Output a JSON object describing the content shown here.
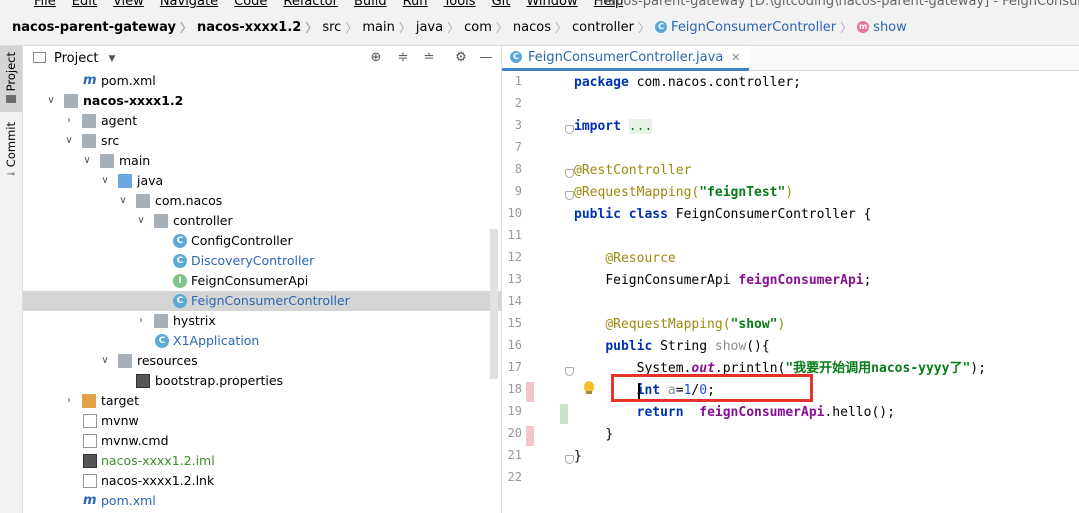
{
  "menubar": {
    "items": [
      "File",
      "Edit",
      "View",
      "Navigate",
      "Code",
      "Refactor",
      "Build",
      "Run",
      "Tools",
      "Git",
      "Window",
      "Help"
    ],
    "window_title": "nacos-parent-gateway [D:\\gitcoding\\nacos-parent-gateway] - FeignConsumerController"
  },
  "breadcrumb": {
    "items": [
      "nacos-parent-gateway",
      "nacos-xxxx1.2",
      "src",
      "main",
      "java",
      "com",
      "nacos",
      "controller",
      "FeignConsumerController",
      "show"
    ]
  },
  "left_strip": {
    "project_label": "Project",
    "commit_label": "Commit"
  },
  "project_panel": {
    "title": "Project",
    "tree": [
      {
        "label": "pom.xml",
        "icon": "maven-icon"
      },
      {
        "label": "nacos-xxxx1.2",
        "icon": "module-folder-icon"
      },
      {
        "label": "agent",
        "icon": "folder-icon"
      },
      {
        "label": "src",
        "icon": "folder-icon"
      },
      {
        "label": "main",
        "icon": "folder-icon"
      },
      {
        "label": "java",
        "icon": "source-folder-icon"
      },
      {
        "label": "com.nacos",
        "icon": "package-icon"
      },
      {
        "label": "controller",
        "icon": "package-icon"
      },
      {
        "label": "ConfigController",
        "icon": "class-icon"
      },
      {
        "label": "DiscoveryController",
        "icon": "class-icon"
      },
      {
        "label": "FeignConsumerApi",
        "icon": "interface-icon"
      },
      {
        "label": "FeignConsumerController",
        "icon": "class-icon"
      },
      {
        "label": "hystrix",
        "icon": "package-icon"
      },
      {
        "label": "X1Application",
        "icon": "spring-class-icon"
      },
      {
        "label": "resources",
        "icon": "resources-folder-icon"
      },
      {
        "label": "bootstrap.properties",
        "icon": "properties-icon"
      },
      {
        "label": "target",
        "icon": "excluded-folder-icon"
      },
      {
        "label": "mvnw",
        "icon": "file-icon"
      },
      {
        "label": "mvnw.cmd",
        "icon": "file-icon"
      },
      {
        "label": "nacos-xxxx1.2.iml",
        "icon": "iml-icon"
      },
      {
        "label": "nacos-xxxx1.2.lnk",
        "icon": "file-icon"
      },
      {
        "label": "pom.xml",
        "icon": "maven-icon"
      }
    ]
  },
  "editor": {
    "tab_label": "FeignConsumerController.java",
    "line_numbers": [
      "1",
      "2",
      "3",
      "7",
      "8",
      "9",
      "10",
      "11",
      "12",
      "13",
      "14",
      "15",
      "16",
      "17",
      "18",
      "19",
      "20",
      "21",
      "22"
    ],
    "code": {
      "l1_kw": "package",
      "l1_rest": " com.nacos.controller;",
      "l3_kw": "import",
      "l3_fold": "...",
      "l8_ann": "@RestController",
      "l9_ann": "@RequestMapping(",
      "l9_str": "\"feignTest\"",
      "l9_end": ")",
      "l10_kw": "public class",
      "l10_rest": " FeignConsumerController {",
      "l12_ann": "@Resource",
      "l13_type": "FeignConsumerApi ",
      "l13_field": "feignConsumerApi",
      "l13_end": ";",
      "l15_ann": "@RequestMapping(",
      "l15_str": "\"show\"",
      "l15_end": ")",
      "l16_kw": "public",
      "l16_type": " String ",
      "l16_method": "show",
      "l16_end": "(){",
      "l17_a": "System.",
      "l17_out": "out",
      "l17_b": ".println(",
      "l17_str": "\"我要开始调用nacos-yyyy了\"",
      "l17_end": ");",
      "l18_kw": "int",
      "l18_var": " a",
      "l18_eq": "=",
      "l18_n1": "1",
      "l18_div": "/",
      "l18_n2": "0",
      "l18_end": ";",
      "l19_kw": "return",
      "l19_field": "  feignConsumerApi",
      "l19_end": ".hello();",
      "l20": "}",
      "l21": "}"
    }
  },
  "colors": {
    "keyword": "#0033b3",
    "annotation": "#9e880d",
    "string": "#067d17",
    "field": "#871094",
    "number": "#1750eb",
    "highlight_box": "#e5322d",
    "selection": "#d5d5d5"
  }
}
